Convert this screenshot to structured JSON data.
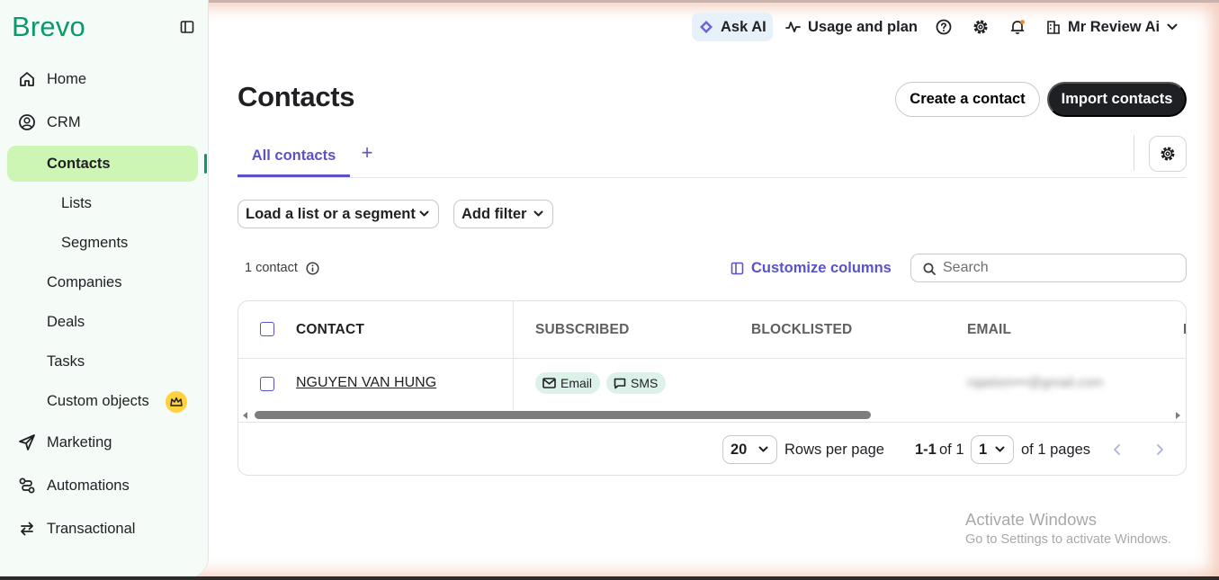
{
  "app": {
    "logo": "Brevo"
  },
  "sidebar": {
    "items": [
      {
        "label": "Home",
        "icon": "home-icon"
      },
      {
        "label": "CRM",
        "icon": "user-circle-icon"
      },
      {
        "label": "Contacts",
        "active": true
      },
      {
        "label": "Lists"
      },
      {
        "label": "Segments"
      },
      {
        "label": "Companies"
      },
      {
        "label": "Deals"
      },
      {
        "label": "Tasks"
      },
      {
        "label": "Custom objects",
        "badge_icon": "crown-icon"
      },
      {
        "label": "Marketing",
        "icon": "paper-plane-icon"
      },
      {
        "label": "Automations",
        "icon": "automation-icon"
      },
      {
        "label": "Transactional",
        "icon": "arrows-exchange-icon"
      }
    ]
  },
  "topbar": {
    "ask_ai": "Ask AI",
    "usage": "Usage and plan",
    "user": "Mr Review Ai"
  },
  "page": {
    "title": "Contacts",
    "create_button": "Create a contact",
    "import_button": "Import contacts",
    "tab_all": "All contacts",
    "tab_add": "+",
    "load_list": "Load a list or a segment",
    "add_filter": "Add filter",
    "contact_count": "1 contact",
    "customize_columns": "Customize columns",
    "search_placeholder": "Search"
  },
  "table": {
    "headers": [
      "CONTACT",
      "SUBSCRIBED",
      "BLOCKLISTED",
      "EMAIL",
      "I"
    ],
    "rows": [
      {
        "contact": "NGUYEN VAN HUNG",
        "subscribed": [
          "Email",
          "SMS"
        ],
        "email": "rajaiism•••@gmail.com"
      }
    ],
    "footer": {
      "rows_per_page_value": "20",
      "rows_per_page_label": "Rows per page",
      "range_bold": "1-1",
      "range_of": "of 1",
      "page_value": "1",
      "pages_label": "of 1 pages"
    }
  },
  "overlay": {
    "activate_title": "Activate Windows",
    "activate_sub": "Go to Settings to activate Windows."
  },
  "colors": {
    "brand": "#0b996e",
    "accent": "#5a52c9",
    "active_nav": "#cdf5b4",
    "dark_button": "#1f2024"
  }
}
